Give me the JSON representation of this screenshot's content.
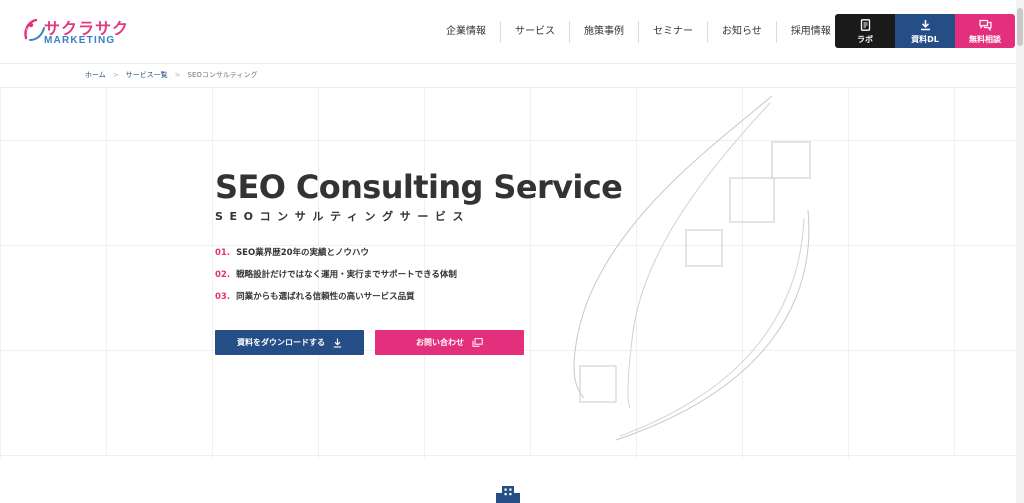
{
  "logo": {
    "text_main": "サクラサク",
    "text_sub": "MARKETING"
  },
  "nav": {
    "items": [
      {
        "label": "企業情報"
      },
      {
        "label": "サービス"
      },
      {
        "label": "施策事例"
      },
      {
        "label": "セミナー"
      },
      {
        "label": "お知らせ"
      },
      {
        "label": "採用情報"
      }
    ]
  },
  "header_buttons": {
    "lab": "ラボ",
    "download": "資料DL",
    "consult": "無料相談"
  },
  "breadcrumb": {
    "home": "ホーム",
    "services": "サービス一覧",
    "current": "SEOコンサルティング",
    "separator": ">"
  },
  "hero": {
    "title": "SEO Consulting Service",
    "subtitle": "SEOコンサルティングサービス"
  },
  "points": [
    {
      "num": "01.",
      "text": "SEO業界歴20年の実績とノウハウ"
    },
    {
      "num": "02.",
      "text": "戦略設計だけではなく運用・実行までサポートできる体制"
    },
    {
      "num": "03.",
      "text": "同業からも選ばれる信頼性の高いサービス品質"
    }
  ],
  "cta": {
    "download": "資料をダウンロードする",
    "contact": "お問い合わせ"
  },
  "colors": {
    "brand_pink": "#e4307c",
    "brand_navy": "#244e85",
    "text": "#333333",
    "black_button": "#1a1a1a"
  },
  "icons": {
    "lab": "document-icon",
    "download": "download-icon",
    "consult": "chat-icon",
    "cta_download": "download-arrow-icon",
    "cta_contact": "external-window-icon",
    "bottom": "building-icon"
  }
}
